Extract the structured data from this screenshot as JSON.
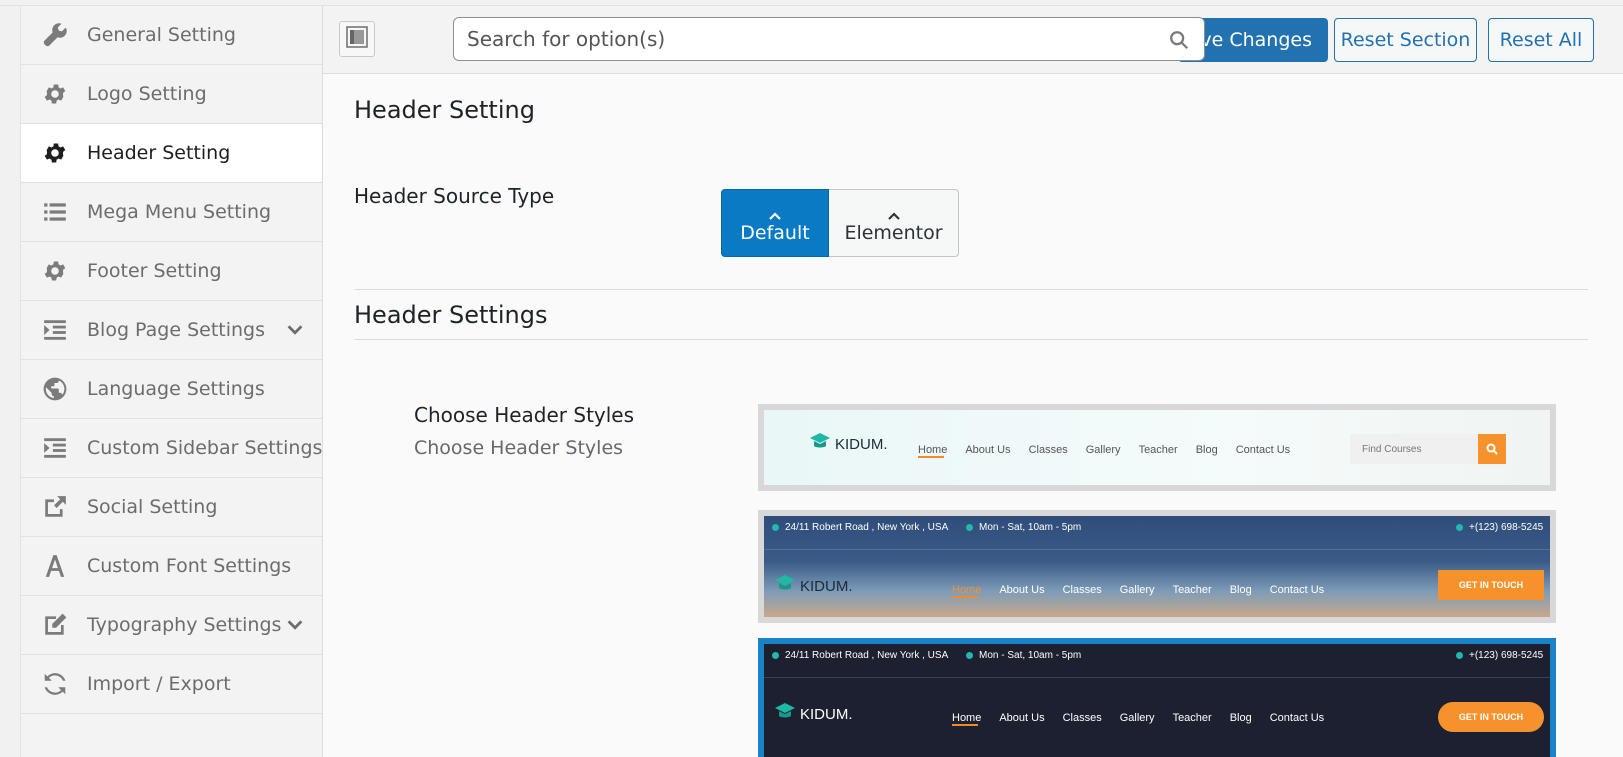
{
  "sidebar": {
    "items": [
      {
        "label": "General Setting",
        "icon": "wrench-icon"
      },
      {
        "label": "Logo Setting",
        "icon": "gear-icon"
      },
      {
        "label": "Header Setting",
        "icon": "gear-icon",
        "active": true
      },
      {
        "label": "Mega Menu Setting",
        "icon": "list-icon"
      },
      {
        "label": "Footer Setting",
        "icon": "gear-icon"
      },
      {
        "label": "Blog Page Settings",
        "icon": "indent-icon",
        "has_submenu": true
      },
      {
        "label": "Language Settings",
        "icon": "globe-icon"
      },
      {
        "label": "Custom Sidebar Settings",
        "icon": "indent-icon"
      },
      {
        "label": "Social Setting",
        "icon": "share-icon"
      },
      {
        "label": "Custom Font Settings",
        "icon": "font-icon"
      },
      {
        "label": "Typography Settings",
        "icon": "edit-icon",
        "has_submenu": true
      },
      {
        "label": "Import / Export",
        "icon": "refresh-icon"
      }
    ]
  },
  "toolbar": {
    "search_placeholder": "Search for option(s)",
    "save_label": "Save Changes",
    "save_visible_label": "ave Changes",
    "reset_section_label": "Reset Section",
    "reset_all_label": "Reset All"
  },
  "section": {
    "title": "Header Setting",
    "source_type_label": "Header Source Type",
    "source_options": [
      "Default",
      "Elementor"
    ],
    "source_selected": "Default",
    "settings_title": "Header Settings",
    "styles_label": "Choose Header Styles",
    "styles_desc": "Choose Header Styles"
  },
  "previews": {
    "brand": "KIDUM.",
    "nav": [
      "Home",
      "About Us",
      "Classes",
      "Gallery",
      "Teacher",
      "Blog",
      "Contact Us"
    ],
    "find_placeholder": "Find Courses",
    "address": "24/11 Robert Road , New York , USA",
    "hours": "Mon - Sat, 10am - 5pm",
    "phone": "+(123) 698-5245",
    "cta": "GET IN TOUCH"
  },
  "colors": {
    "accent": "#2271b1",
    "selected": "#0a7ac4",
    "orange": "#f6922b",
    "teal": "#20b9ad"
  }
}
